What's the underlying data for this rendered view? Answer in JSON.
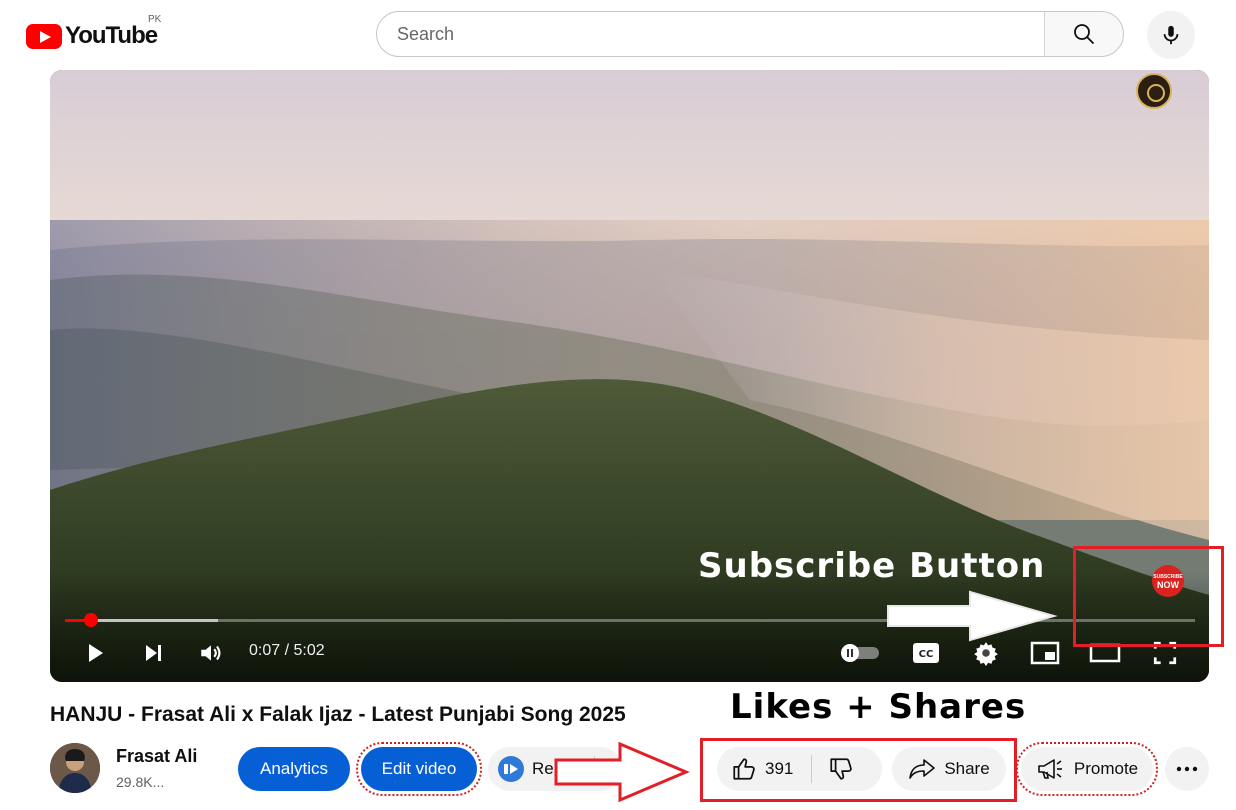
{
  "header": {
    "logo_text": "YouTube",
    "country_code": "PK",
    "search_placeholder": "Search"
  },
  "player": {
    "current_time": "0:07",
    "duration": "5:02",
    "time_display": "0:07 / 5:02",
    "progress_fraction": 0.023,
    "buffer_fraction": 0.135,
    "subscribe_badge_line1": "SUBSCRIBE",
    "subscribe_badge_line2": "NOW"
  },
  "annotations": {
    "subscribe_label": "Subscribe Button",
    "likes_shares_label": "Likes + Shares",
    "annotation_color": "#e21f26"
  },
  "video": {
    "title": "HANJU - Frasat Ali x Falak Ijaz - Latest Punjabi Song 2025",
    "channel_name": "Frasat Ali",
    "subscribers": "29.8K..."
  },
  "actions": {
    "analytics_label": "Analytics",
    "edit_label": "Edit video",
    "remix_label": "Remix",
    "like_count": "391",
    "share_label": "Share",
    "promote_label": "Promote"
  },
  "colors": {
    "brand_red": "#ff0000",
    "action_blue": "#065fd4"
  }
}
